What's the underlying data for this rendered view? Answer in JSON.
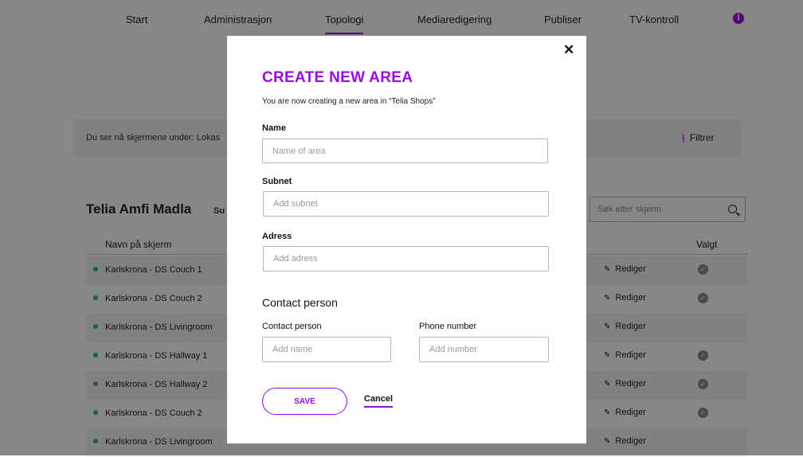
{
  "nav": {
    "items": [
      "Start",
      "Administrasjon",
      "Topologi",
      "Mediaredigering",
      "Publiser",
      "TV-kontroll"
    ],
    "active": "Topologi",
    "info_glyph": "i"
  },
  "filter": {
    "text": "Du ser nå skjermene under:  Lokas",
    "button_label": "Filtrer",
    "icon": "sliders-icon"
  },
  "location": {
    "title": "Telia Amfi Madla",
    "sub_fragment": "Su"
  },
  "search": {
    "placeholder": "Søk etter skjerm"
  },
  "table": {
    "columns": {
      "name": "Navn på skjerm",
      "selected": "Valgt"
    },
    "rows": [
      {
        "name": "Karlskrona - DS Couch 1",
        "edit": "Rediger",
        "selected": true
      },
      {
        "name": "Karlskrona - DS Couch 2",
        "edit": "Rediger",
        "selected": true
      },
      {
        "name": "Karlskrona - DS Livingroom",
        "edit": "Rediger",
        "selected": false
      },
      {
        "name": "Karlskrona - DS Hallway 1",
        "edit": "Rediger",
        "selected": true
      },
      {
        "name": "Karlskrona - DS Hallway 2",
        "edit": "Rediger",
        "selected": true
      },
      {
        "name": "Karlskrona - DS Couch 2",
        "edit": "Rediger",
        "selected": true
      },
      {
        "name": "Karlskrona - DS Livingroom",
        "edit": "Rediger",
        "selected": false
      }
    ],
    "check_glyph": "✓"
  },
  "modal": {
    "close_glyph": "✕",
    "title": "CREATE NEW AREA",
    "subtitle": "You are now creating a new area in “Telia Shops”",
    "name": {
      "label": "Name",
      "placeholder": "Name of area",
      "value": ""
    },
    "subnet": {
      "label": "Subnet",
      "placeholder": "Add subnet",
      "value": ""
    },
    "address": {
      "label": "Adress",
      "placeholder": "Add adress",
      "value": ""
    },
    "contact_section": "Contact person",
    "contact": {
      "label": "Contact person",
      "placeholder": "Add name",
      "value": ""
    },
    "phone": {
      "label": "Phone number",
      "placeholder": "Add number",
      "value": ""
    },
    "save_label": "SAVE",
    "cancel_label": "Cancel"
  },
  "colors": {
    "accent": "#990ae3",
    "status_green": "#1ec36b",
    "overlay": "rgba(0,0,0,0.47)"
  }
}
